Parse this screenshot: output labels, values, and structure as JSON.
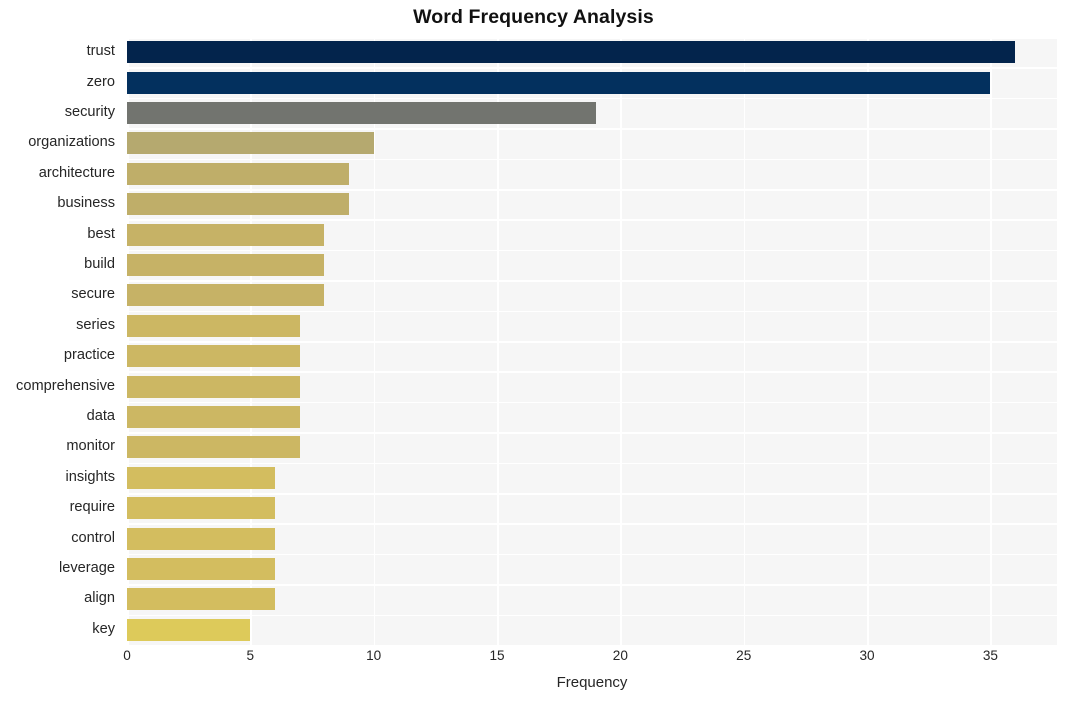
{
  "chart_data": {
    "type": "bar",
    "orientation": "horizontal",
    "title": "Word Frequency Analysis",
    "xlabel": "Frequency",
    "ylabel": "",
    "categories": [
      "trust",
      "zero",
      "security",
      "organizations",
      "architecture",
      "business",
      "best",
      "build",
      "secure",
      "series",
      "practice",
      "comprehensive",
      "data",
      "monitor",
      "insights",
      "require",
      "control",
      "leverage",
      "align",
      "key"
    ],
    "values": [
      36,
      35,
      19,
      10,
      9,
      9,
      8,
      8,
      8,
      7,
      7,
      7,
      7,
      7,
      6,
      6,
      6,
      6,
      6,
      5
    ],
    "bar_colors": [
      "#03244c",
      "#03305e",
      "#72746f",
      "#b5a96f",
      "#bfae69",
      "#bfae69",
      "#c6b266",
      "#c6b266",
      "#c6b266",
      "#ccb763",
      "#ccb763",
      "#ccb763",
      "#ccb763",
      "#ccb763",
      "#d3bd5f",
      "#d3bd5f",
      "#d3bd5f",
      "#d3bd5f",
      "#d3bd5f",
      "#ddca5a"
    ],
    "xlim": [
      0,
      37.7
    ],
    "xticks": [
      0,
      5,
      10,
      15,
      20,
      25,
      30,
      35
    ],
    "xtick_labels": [
      "0",
      "5",
      "10",
      "15",
      "20",
      "25",
      "30",
      "35"
    ],
    "grid": true,
    "grid_color": "#ffffff",
    "plot_background": "#f6f6f6",
    "figure_background": "#ffffff",
    "legend": null
  }
}
